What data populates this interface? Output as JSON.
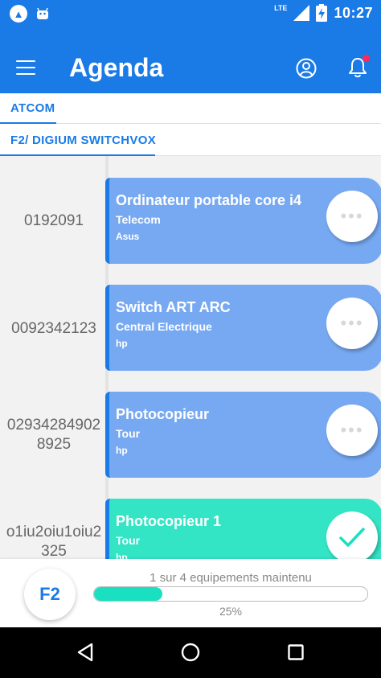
{
  "status_bar": {
    "time": "10:27",
    "network": "LTE",
    "icons": [
      "app-notification-icon",
      "android-icon",
      "signal-icon",
      "battery-charging-icon"
    ]
  },
  "app_bar": {
    "title": "Agenda",
    "menu_icon": "hamburger-menu-icon",
    "profile_icon": "user-profile-icon",
    "notification_icon": "bell-icon",
    "has_notification_dot": true
  },
  "tabs": {
    "primary": "ATCOM",
    "secondary": "F2/ DIGIUM SWITCHVOX"
  },
  "items": [
    {
      "code": "0192091",
      "title": "Ordinateur portable core i4",
      "category": "Telecom",
      "brand": "Asus",
      "status": "pending"
    },
    {
      "code": "0092342123",
      "title": "Switch ART ARC",
      "category": "Central Electrique",
      "brand": "hp",
      "status": "pending"
    },
    {
      "code": "029342849028925",
      "title": "Photocopieur",
      "category": "Tour",
      "brand": "hp",
      "status": "pending"
    },
    {
      "code": "o1iu2oiu1oiu2325",
      "title": "Photocopieur 1",
      "category": "Tour",
      "brand": "hp",
      "status": "done"
    }
  ],
  "summary": {
    "fab_label": "F2",
    "progress_text": "1 sur 4 equipements maintenu",
    "progress_fraction": 0.25,
    "progress_percent_label": "25%"
  },
  "colors": {
    "primary": "#1a7ae6",
    "card_pending": "#77a9f2",
    "card_done": "#33e4c5",
    "progress": "#19e0c1",
    "notification_dot": "#ff2a55"
  },
  "nav": {
    "icons": [
      "back-icon",
      "home-icon",
      "recent-apps-icon"
    ]
  }
}
